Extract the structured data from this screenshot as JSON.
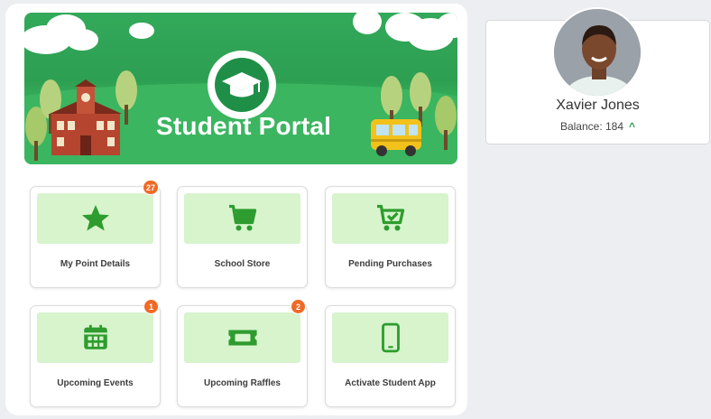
{
  "banner": {
    "title": "Student Portal"
  },
  "tiles": [
    {
      "label": "My Point Details",
      "badge": "27",
      "icon": "star-icon"
    },
    {
      "label": "School Store",
      "badge": "",
      "icon": "cart-icon"
    },
    {
      "label": "Pending Purchases",
      "badge": "",
      "icon": "cart-check-icon"
    },
    {
      "label": "Upcoming Events",
      "badge": "1",
      "icon": "calendar-icon"
    },
    {
      "label": "Upcoming Raffles",
      "badge": "2",
      "icon": "ticket-icon"
    },
    {
      "label": "Activate Student App",
      "badge": "",
      "icon": "phone-icon"
    }
  ],
  "profile": {
    "name": "Xavier Jones",
    "balance": "Balance: 184",
    "balance_icon": "caret-up-icon"
  },
  "colors": {
    "accent_green": "#2aa552",
    "icon_green": "#2e9c2e",
    "tile_bg": "#d7f4cd",
    "badge": "#ef6a26"
  }
}
